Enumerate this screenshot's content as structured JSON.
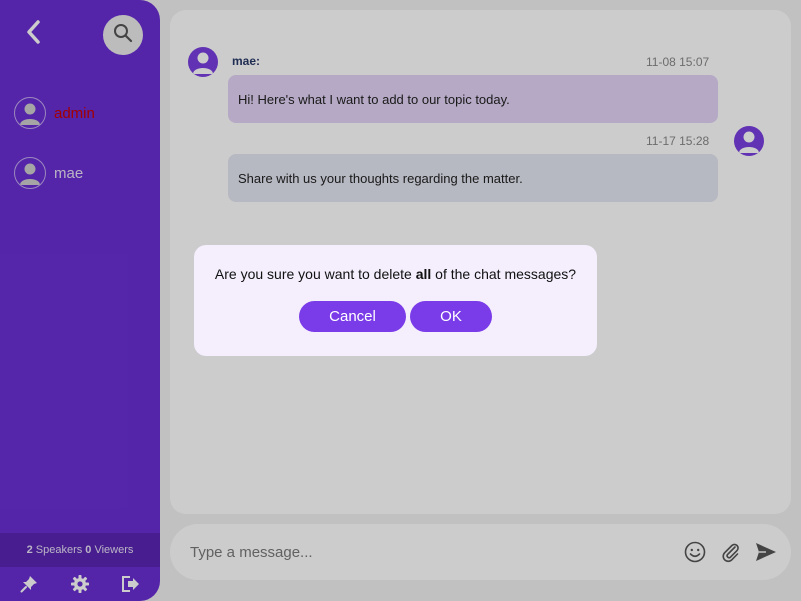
{
  "sidebar": {
    "users": [
      {
        "name": "admin"
      },
      {
        "name": "mae"
      }
    ],
    "stats": {
      "speakers_count": "2",
      "speakers_label": " Speakers ",
      "viewers_count": "0",
      "viewers_label": " Viewers"
    },
    "icons": [
      "back-arrow-icon",
      "search-icon",
      "pin-icon",
      "gear-icon",
      "logout-icon"
    ]
  },
  "chat": {
    "messages": [
      {
        "sender": "mae:",
        "time": "11-08 15:07",
        "text": "Hi! Here's what I want to add to our topic today."
      },
      {
        "sender": "",
        "time": "11-17 15:28",
        "text": "Share with us your thoughts regarding the matter."
      }
    ]
  },
  "input": {
    "placeholder": "Type a message..."
  },
  "dialog": {
    "text_before": "Are you sure you want to delete ",
    "text_bold": "all",
    "text_after": " of the chat messages?",
    "cancel_label": "Cancel",
    "ok_label": "OK"
  },
  "colors": {
    "sidebar": "#6a2fd4",
    "accent": "#7a3be8",
    "admin_name": "#cc0000",
    "dialog_bg": "#f4eefd"
  }
}
